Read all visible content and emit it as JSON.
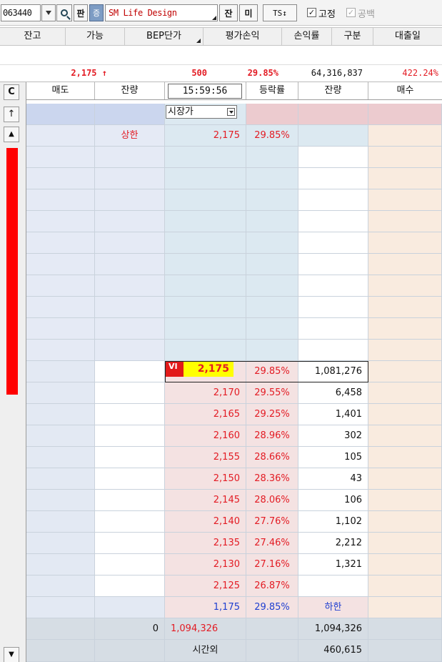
{
  "toolbar": {
    "code": "063440",
    "pan_label": "판",
    "badge_label": "증",
    "stock_name": "SM Life Design",
    "jan_label": "잔",
    "mi_label": "미",
    "ts_label": "TS↕",
    "fixed_label": "고정",
    "blank_label": "공백",
    "check_mark": "✓",
    "icons": {
      "dropdown": "chevron-down-icon",
      "search": "search-icon"
    }
  },
  "position_headers": [
    "잔고",
    "가능",
    "BEP단가",
    "평가손익",
    "손익률",
    "구분",
    "대출일"
  ],
  "summary": {
    "price": "2,175",
    "price_arrow": "↑",
    "volume": "500",
    "change_rate": "29.85%",
    "trade_amount": "64,316,837",
    "ratio": "422.24%"
  },
  "orderbook": {
    "header": {
      "corner": "C",
      "sell": "매도",
      "sell_qty": "잔량",
      "time": "15:59:56",
      "rate": "등락률",
      "buy_qty": "잔량",
      "buy": "매수"
    },
    "market_price_label": "시장가",
    "upper_limit_label": "상한",
    "upper_limit_price": "2,175",
    "upper_limit_rate": "29.85%",
    "vi_label": "VI",
    "current_price": "2,175",
    "current_rate": "29.85%",
    "current_bid_qty": "1,081,276",
    "bids": [
      {
        "price": "2,170",
        "rate": "29.55%",
        "qty": "6,458"
      },
      {
        "price": "2,165",
        "rate": "29.25%",
        "qty": "1,401"
      },
      {
        "price": "2,160",
        "rate": "28.96%",
        "qty": "302"
      },
      {
        "price": "2,155",
        "rate": "28.66%",
        "qty": "105"
      },
      {
        "price": "2,150",
        "rate": "28.36%",
        "qty": "43"
      },
      {
        "price": "2,145",
        "rate": "28.06%",
        "qty": "106"
      },
      {
        "price": "2,140",
        "rate": "27.76%",
        "qty": "1,102"
      },
      {
        "price": "2,135",
        "rate": "27.46%",
        "qty": "2,212"
      },
      {
        "price": "2,130",
        "rate": "27.16%",
        "qty": "1,321"
      },
      {
        "price": "2,125",
        "rate": "26.87%",
        "qty": ""
      }
    ],
    "lower_limit_price": "1,175",
    "lower_limit_rate": "29.85%",
    "lower_limit_label": "하한",
    "total_ask_qty": "0",
    "total_center": "1,094,326",
    "total_bid_qty": "1,094,326",
    "after_hours_label": "시간외",
    "after_hours_bid_qty": "460,615"
  },
  "strip": {
    "corner": "C",
    "up_arrow": "↑",
    "scroll_up": "▲",
    "scroll_down": "▼"
  },
  "colors": {
    "up": "#e31b23",
    "down": "#1f3fd0",
    "highlight": "#ffff00",
    "vi": "#e21a1a"
  }
}
